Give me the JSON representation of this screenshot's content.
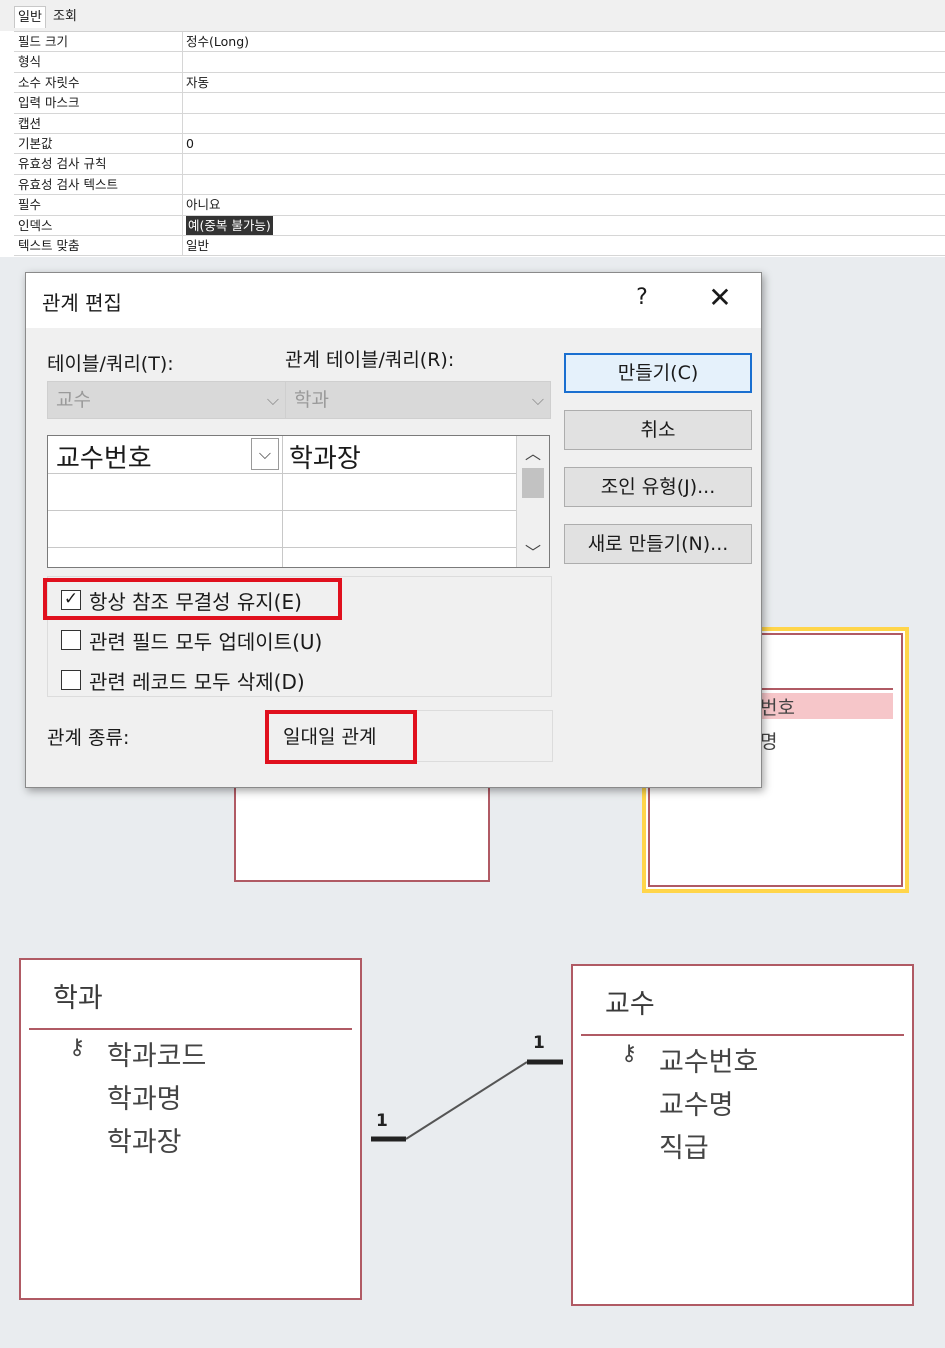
{
  "property_sheet": {
    "tabs": [
      {
        "label": "일반"
      },
      {
        "label": "조회"
      }
    ],
    "rows": [
      {
        "label": "필드 크기",
        "value": "정수(Long)"
      },
      {
        "label": "형식",
        "value": ""
      },
      {
        "label": "소수 자릿수",
        "value": "자동"
      },
      {
        "label": "입력 마스크",
        "value": ""
      },
      {
        "label": "캡션",
        "value": ""
      },
      {
        "label": "기본값",
        "value": "0"
      },
      {
        "label": "유효성 검사 규칙",
        "value": ""
      },
      {
        "label": "유효성 검사 텍스트",
        "value": ""
      },
      {
        "label": "필수",
        "value": "아니요"
      },
      {
        "label": "인덱스",
        "value": "예(중복 불가능)"
      },
      {
        "label": "텍스트 맞춤",
        "value": "일반"
      }
    ]
  },
  "dialog": {
    "title": "관계 편집",
    "help": "?",
    "close": "✕",
    "table_label": "테이블/쿼리(T):",
    "related_label": "관계 테이블/쿼리(R):",
    "table_value": "교수",
    "related_value": "학과",
    "field_left": "교수번호",
    "field_right": "학과장",
    "options": {
      "enforce": "항상 참조 무결성 유지(E)",
      "cascade_update": "관련 필드 모두 업데이트(U)",
      "cascade_delete": "관련 레코드 모두 삭제(D)"
    },
    "reltype_label": "관계 종류:",
    "reltype_value": "일대일 관계",
    "buttons": {
      "create": "만들기(C)",
      "cancel": "취소",
      "join": "조인 유형(J)...",
      "new": "새로 만들기(N)..."
    }
  },
  "background_boxes": {
    "right_partial": {
      "field1": "번호",
      "field2": "명"
    }
  },
  "tables": {
    "hakgwa": {
      "title": "학과",
      "fields": [
        "학과코드",
        "학과명",
        "학과장"
      ]
    },
    "gyosu": {
      "title": "교수",
      "fields": [
        "교수번호",
        "교수명",
        "직급"
      ]
    }
  },
  "connector": {
    "left_label": "1",
    "right_label": "1"
  }
}
